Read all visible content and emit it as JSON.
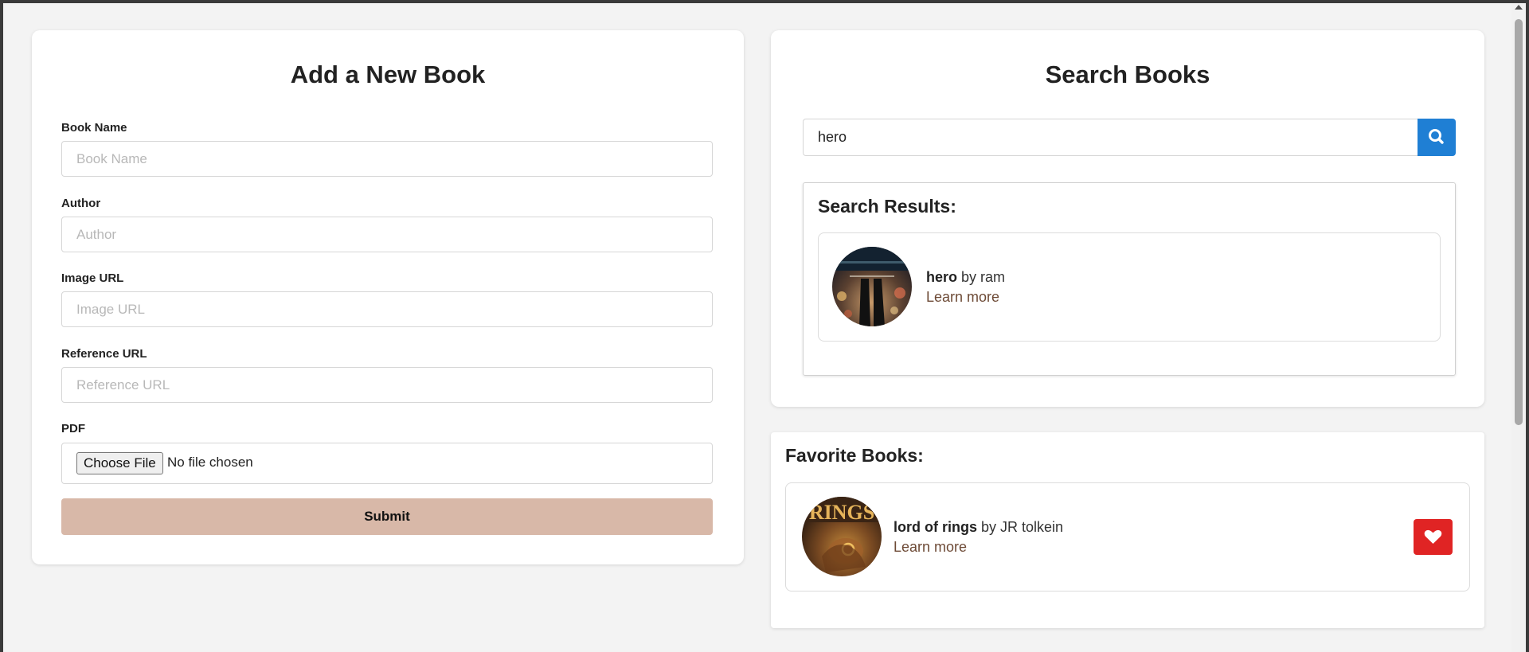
{
  "add_form": {
    "title": "Add a New Book",
    "fields": [
      {
        "label": "Book Name",
        "placeholder": "Book Name",
        "value": ""
      },
      {
        "label": "Author",
        "placeholder": "Author",
        "value": ""
      },
      {
        "label": "Image URL",
        "placeholder": "Image URL",
        "value": ""
      },
      {
        "label": "Reference URL",
        "placeholder": "Reference URL",
        "value": ""
      }
    ],
    "pdf": {
      "label": "PDF",
      "choose_label": "Choose File",
      "status": "No file chosen"
    },
    "submit_label": "Submit"
  },
  "search": {
    "title": "Search Books",
    "query": "hero",
    "button_icon": "search-icon",
    "results_title": "Search Results:",
    "results": [
      {
        "title": "hero",
        "by": "by ram",
        "link": "Learn more",
        "cover_icon": "book-cover-hero"
      }
    ]
  },
  "favorites": {
    "title": "Favorite Books:",
    "items": [
      {
        "title": "lord of rings",
        "by": "by JR tolkein",
        "link": "Learn more",
        "cover_icon": "book-cover-lotr",
        "action_icon": "heart-icon"
      }
    ]
  },
  "colors": {
    "page_bg": "#f3f3f3",
    "card_bg": "#ffffff",
    "submit_bg": "#d8b8a8",
    "search_button": "#1f7fd4",
    "heart_button": "#e02424",
    "link": "#6d4a36"
  }
}
